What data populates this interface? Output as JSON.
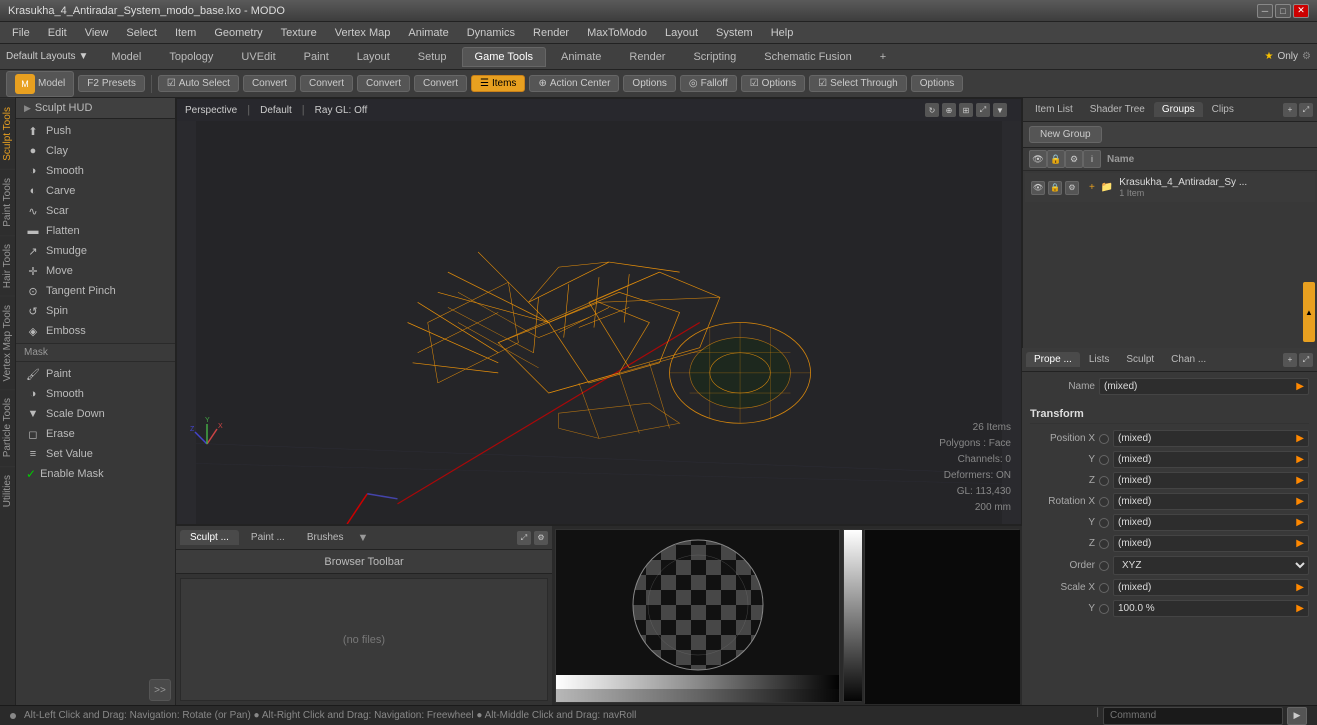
{
  "titlebar": {
    "title": "Krasukha_4_Antiradar_System_modo_base.lxo - MODO",
    "min": "─",
    "max": "□",
    "close": "✕"
  },
  "menubar": {
    "items": [
      "File",
      "Edit",
      "View",
      "Select",
      "Item",
      "Geometry",
      "Texture",
      "Vertex Map",
      "Animate",
      "Dynamics",
      "Render",
      "MaxToModo",
      "Layout",
      "System",
      "Help"
    ]
  },
  "layouts": {
    "label": "Default Layouts",
    "icon": "▼"
  },
  "tabbar": {
    "tabs": [
      "Model",
      "Topology",
      "UVEdit",
      "Paint",
      "Layout",
      "Setup",
      "Game Tools",
      "Animate",
      "Render",
      "Scripting",
      "Schematic Fusion"
    ],
    "active": "Game Tools",
    "plus": "+"
  },
  "toolbar": {
    "model_btn": "Model",
    "presets": "F2",
    "presets_label": "Presets",
    "auto_select": "Auto Select",
    "convert1": "Convert",
    "convert2": "Convert",
    "convert3": "Convert",
    "convert4": "Convert",
    "items_btn": "Items",
    "action_center": "Action Center",
    "options1": "Options",
    "falloff": "Falloff",
    "options2": "Options",
    "select_through": "Select Through"
  },
  "sculpt_hud": "Sculpt HUD",
  "tools": {
    "main": [
      {
        "label": "Push",
        "icon": "⬆"
      },
      {
        "label": "Clay",
        "icon": "●"
      },
      {
        "label": "Smooth",
        "icon": "◑"
      },
      {
        "label": "Carve",
        "icon": "◐"
      },
      {
        "label": "Scar",
        "icon": "∿"
      },
      {
        "label": "Flatten",
        "icon": "▬"
      },
      {
        "label": "Smudge",
        "icon": "↗"
      },
      {
        "label": "Move",
        "icon": "✛"
      },
      {
        "label": "Tangent Pinch",
        "icon": "⊙"
      },
      {
        "label": "Spin",
        "icon": "↺"
      },
      {
        "label": "Emboss",
        "icon": "◈"
      }
    ],
    "mask_section": "Mask",
    "mask": [
      {
        "label": "Paint",
        "icon": "🖌"
      },
      {
        "label": "Smooth",
        "icon": "◑"
      },
      {
        "label": "Scale Down",
        "icon": "▼"
      }
    ],
    "erase": {
      "label": "Erase",
      "icon": "◻"
    },
    "set_value": {
      "label": "Set Value",
      "icon": "≡"
    },
    "enable_mask": {
      "label": "Enable Mask",
      "checked": true
    }
  },
  "vtabs": [
    "Sculpt Tools",
    "Paint Tools",
    "Hair Tools",
    "Vertex Map Tools",
    "Particle Tools",
    "Utilities"
  ],
  "viewport": {
    "label1": "Perspective",
    "label2": "Default",
    "label3": "Ray GL: Off",
    "stats": {
      "items": "26 Items",
      "polygons": "Polygons : Face",
      "channels": "Channels: 0",
      "deformers": "Deformers: ON",
      "gl": "GL: 113,430",
      "size": "200 mm"
    }
  },
  "bottom": {
    "tabs": [
      "Sculpt ...",
      "Paint ...",
      "Brushes"
    ],
    "active": "Sculpt ...",
    "browser_toolbar": "Browser Toolbar",
    "no_files": "(no files)"
  },
  "right_panel": {
    "tabs": [
      "Item List",
      "Shader Tree",
      "Groups",
      "Clips"
    ],
    "active": "Groups",
    "new_group": "New Group",
    "name_col": "Name",
    "item": {
      "name": "Krasukha_4_Antiradar_Sy ...",
      "count": "1 Item"
    }
  },
  "properties": {
    "tabs": [
      "Prope ...",
      "Lists",
      "Sculpt",
      "Chan ..."
    ],
    "active": "Prope ...",
    "name_label": "Name",
    "name_value": "(mixed)",
    "section": "Transform",
    "fields": [
      {
        "label": "Position X",
        "value": "(mixed)"
      },
      {
        "label": "Y",
        "value": "(mixed)"
      },
      {
        "label": "Z",
        "value": "(mixed)"
      },
      {
        "label": "Rotation X",
        "value": "(mixed)"
      },
      {
        "label": "Y",
        "value": "(mixed)"
      },
      {
        "label": "Z",
        "value": "(mixed)"
      },
      {
        "label": "Order",
        "value": "XYZ",
        "is_dropdown": true
      },
      {
        "label": "Scale X",
        "value": "(mixed)"
      },
      {
        "label": "Y",
        "value": "100.0 %"
      }
    ]
  },
  "statusbar": {
    "text": "Alt-Left Click and Drag: Navigation: Rotate (or Pan) ● Alt-Right Click and Drag: Navigation: Freewheel ● Alt-Middle Click and Drag: navRoll"
  },
  "cmdbar": {
    "placeholder": "Command"
  }
}
